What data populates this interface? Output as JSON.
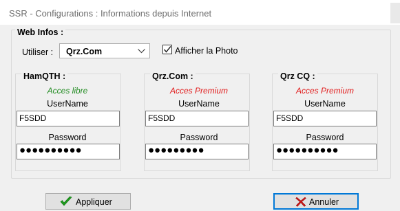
{
  "window": {
    "title": "SSR - Configurations : Informations depuis Internet"
  },
  "web_infos": {
    "legend": "Web Infos :",
    "utiliser_label": "Utiliser :",
    "selected_service": "Qrz.Com",
    "show_photo_label": "Afficher la Photo",
    "show_photo_checked": true
  },
  "services": [
    {
      "name": "HamQTH :",
      "access": "Acces libre",
      "access_color": "#1f8a1f",
      "username_label": "UserName",
      "username": "F5SDD",
      "password_label": "Password",
      "password": "●●●●●●●●●●"
    },
    {
      "name": "Qrz.Com :",
      "access": "Acces Premium",
      "access_color": "#e11b1b",
      "username_label": "UserName",
      "username": "F5SDD",
      "password_label": "Password",
      "password": "●●●●●●●●●"
    },
    {
      "name": "Qrz CQ :",
      "access": "Acces Premium",
      "access_color": "#e11b1b",
      "username_label": "UserName",
      "username": "F5SDD",
      "password_label": "Password",
      "password": "●●●●●●●●●●"
    }
  ],
  "buttons": {
    "apply_label": "Appliquer",
    "cancel_label": "Annuler",
    "apply_icon": "green-checkmark-icon",
    "cancel_icon": "red-x-icon"
  }
}
